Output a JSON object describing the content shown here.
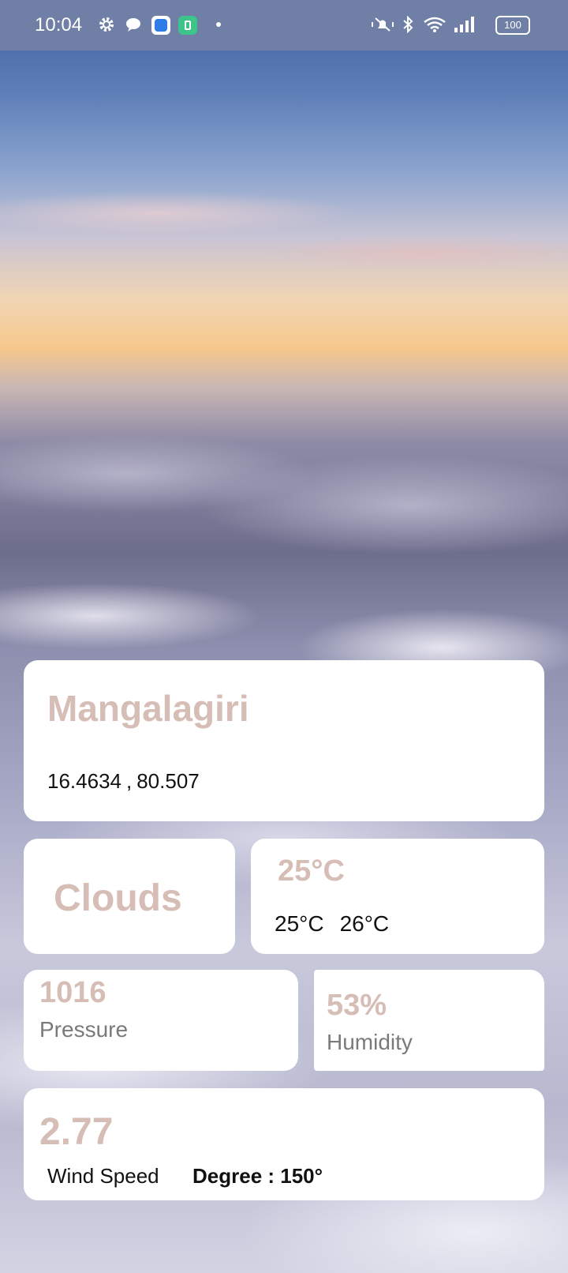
{
  "status_bar": {
    "time": "10:04",
    "left_icons": [
      "gear-icon",
      "cloud-chat-icon",
      "app-icon-blue",
      "app-icon-green",
      "dot-icon"
    ],
    "right_icons": [
      "mute-vibrate-icon",
      "bluetooth-icon",
      "wifi-icon",
      "signal-icon"
    ],
    "battery": "100"
  },
  "location": {
    "city": "Mangalagiri",
    "lat": "16.4634",
    "sep": ",",
    "lon": "80.507"
  },
  "weather": {
    "main": "Clouds",
    "temp": "25°C",
    "temp_min": "25°C",
    "temp_max": "26°C"
  },
  "pressure": {
    "value": "1016",
    "label": "Pressure"
  },
  "humidity": {
    "value": "53%",
    "label": "Humidity"
  },
  "wind": {
    "speed": "2.77",
    "label": "Wind Speed",
    "degree": "Degree : 150°"
  },
  "colors": {
    "accent_text": "#d6bdb5",
    "card_bg": "#ffffff",
    "status_bar_bg": "#6f7fa6"
  }
}
